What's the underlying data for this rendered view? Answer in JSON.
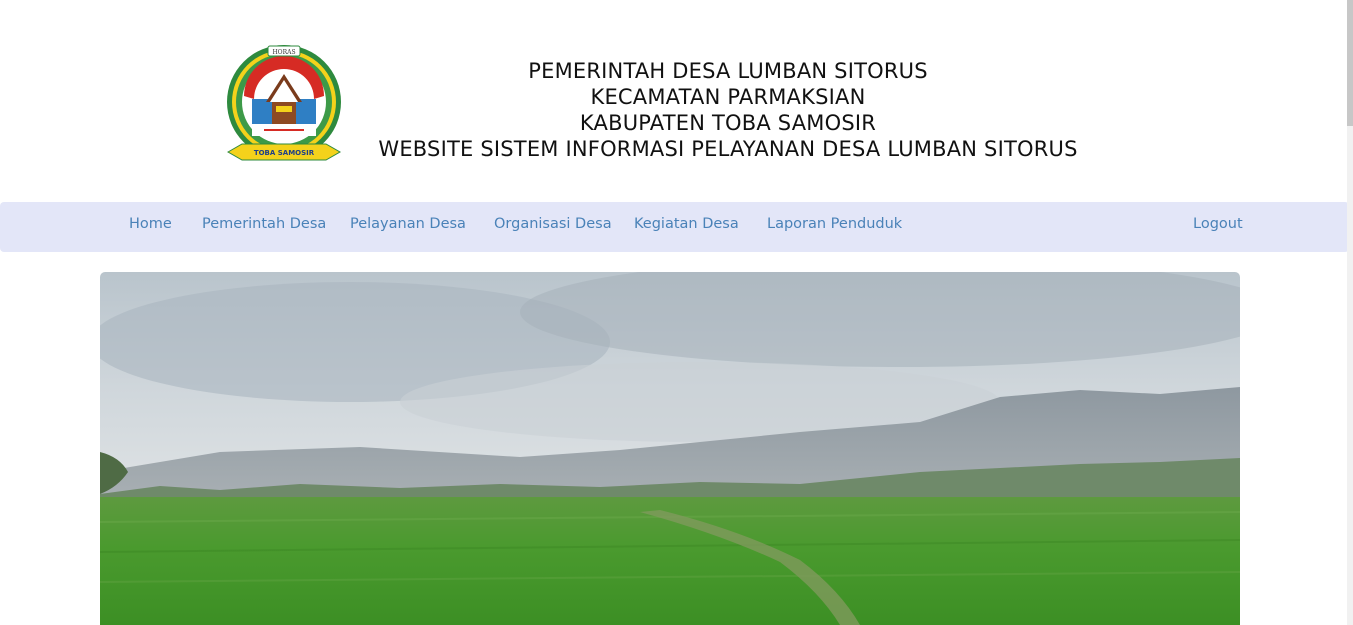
{
  "header": {
    "logo_name": "Toba Samosir emblem",
    "logo_text": "TOBA SAMOSIR",
    "logo_top_text": "HORAS",
    "title_lines": [
      "PEMERINTAH DESA LUMBAN SITORUS",
      "KECAMATAN PARMAKSIAN",
      "KABUPATEN TOBA SAMOSIR",
      "WEBSITE SISTEM INFORMASI PELAYANAN DESA LUMBAN SITORUS"
    ]
  },
  "nav": {
    "items": [
      {
        "label": "Home"
      },
      {
        "label": "Pemerintah Desa"
      },
      {
        "label": "Pelayanan Desa"
      },
      {
        "label": "Organisasi Desa"
      },
      {
        "label": "Kegiatan Desa"
      },
      {
        "label": "Laporan Penduduk"
      }
    ],
    "logout_label": "Logout"
  },
  "colors": {
    "nav_background": "#e3e6f8",
    "nav_link": "#4a82b8",
    "title_text": "#111111"
  },
  "hero": {
    "image_description_name": "rice-field-landscape"
  }
}
